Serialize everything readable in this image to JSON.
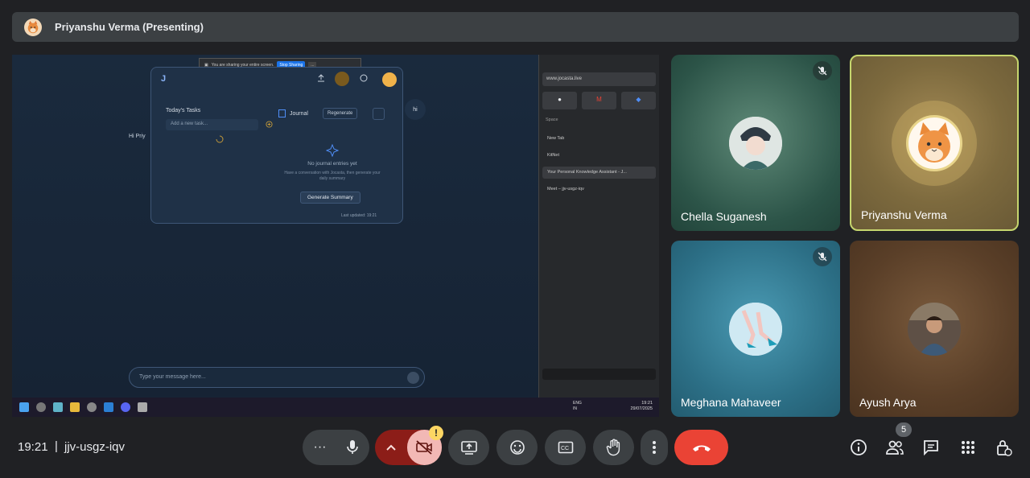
{
  "presenter": {
    "title": "Priyanshu Verma (Presenting)"
  },
  "shared_screen": {
    "share_banner": {
      "text": "You are sharing your entire screen.",
      "stop_label": "Stop Sharing",
      "more_label": "..."
    },
    "panel": {
      "tasks_title": "Today's Tasks",
      "task_placeholder": "Add a new task...",
      "journal_title": "Journal",
      "regenerate_label": "Regenerate",
      "no_entries": "No journal entries yet",
      "hint": "Have a conversation with Jocasta, then generate your daily summary",
      "generate_label": "Generate Summary",
      "last_updated": "Last updated: 19:21"
    },
    "chat_greeting": "Hi Priy",
    "hi_bubble": "hi",
    "message_placeholder": "Type your message here...",
    "browser_sidebar": {
      "url": "www.jocasta.live",
      "section": "Space",
      "items": [
        {
          "label": "New Tab"
        },
        {
          "label": "KitNet"
        },
        {
          "label": "Your Personal Knowledge Assistant - J..."
        },
        {
          "label": "Meet – jjv-usgz-iqv"
        }
      ]
    },
    "taskbar": {
      "lang_top": "ENG",
      "lang_bottom": "IN",
      "time": "19:21",
      "date": "29/07/2025"
    }
  },
  "participants": [
    {
      "name": "Chella Suganesh",
      "muted": true
    },
    {
      "name": "Priyanshu Verma",
      "muted": false,
      "speaking": true
    },
    {
      "name": "Meghana Mahaveer",
      "muted": true
    },
    {
      "name": "Ayush Arya",
      "muted": false
    }
  ],
  "meeting": {
    "time": "19:21",
    "separator": "|",
    "code": "jjv-usgz-iqv",
    "participant_count": "5"
  },
  "controls": {
    "more_label": "···",
    "camera_warning": "!"
  },
  "colors": {
    "end_call": "#ea4335",
    "camera_off": "#8c1d18",
    "speaking_ring": "#c6d66e",
    "mute_icon": "#e8eaed"
  }
}
